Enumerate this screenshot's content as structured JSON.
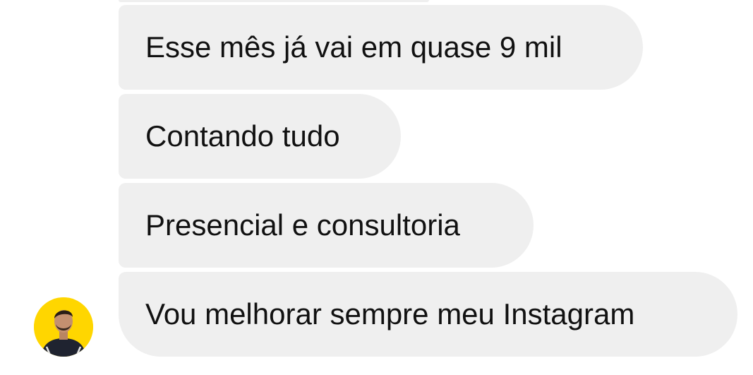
{
  "conversation": {
    "messages": [
      {
        "text": "Esse mês já vai em quase 9 mil"
      },
      {
        "text": "Contando tudo"
      },
      {
        "text": "Presencial e consultoria"
      },
      {
        "text": "Vou melhorar sempre meu Instagram"
      }
    ],
    "sender": {
      "avatar_icon": "person-avatar-icon",
      "avatar_bg": "#ffd600"
    },
    "bubble_color": "#efefef",
    "text_color": "#111111"
  }
}
